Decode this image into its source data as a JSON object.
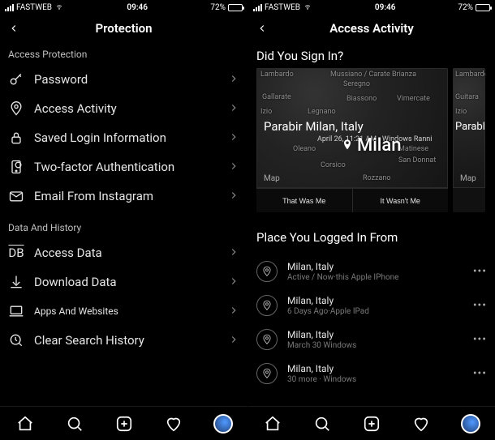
{
  "status": {
    "carrier": "FASTWEB",
    "time": "09:46",
    "battery_pct": "72%"
  },
  "left": {
    "header_title": "Protection",
    "section_access_protection": "Access Protection",
    "items": {
      "password": "Password",
      "access_activity": "Access Activity",
      "saved_login": "Saved Login Information",
      "two_factor": "Two-factor Authentication",
      "email_instagram": "Email From Instagram"
    },
    "section_data_history": "Data And History",
    "data_items": {
      "access_data": "Access Data",
      "download_data": "Download Data",
      "apps_websites": "Apps And Websites",
      "clear_search": "Clear Search History"
    }
  },
  "right": {
    "header_title": "Access Activity",
    "did_you_sign_in": "Did You Sign In?",
    "card": {
      "title": "Parabir Milan, Italy",
      "subtitle": "April 26, 11:21 AM · Windows Ranni",
      "city_big": "Milan",
      "map_label": "Map",
      "this_was_me": "That Was Me",
      "it_wasnt_me": "It Wasn't Me",
      "peek_title": "Parable",
      "labels": {
        "lambardo": "Lambardo",
        "mussiano": "Mussiano / Carate Brianza",
        "seregno": "Seregno",
        "gallarate": "Gallarate",
        "biassono": "Biassono",
        "vimercate": "Vimercate",
        "izio": "Izio",
        "legnano": "Legnano",
        "oleano": "Oleano",
        "matinese": "Matinese",
        "san_donnat": "San Donnat",
        "corsico": "Corsico",
        "rozzano": "Rozzano",
        "guitara": "Guitara"
      }
    },
    "logged_in_from": "Place You Logged In From",
    "logins": [
      {
        "title": "Milan, Italy",
        "sub": "Active / Now·this Apple IPhone"
      },
      {
        "title": "Milan, Italy",
        "sub": "6 Days Ago·Apple IPad"
      },
      {
        "title": "Milan, Italy",
        "sub": "March 30 Windows"
      },
      {
        "title": "Milan, Italy",
        "sub": "30 more · Windows"
      }
    ]
  }
}
